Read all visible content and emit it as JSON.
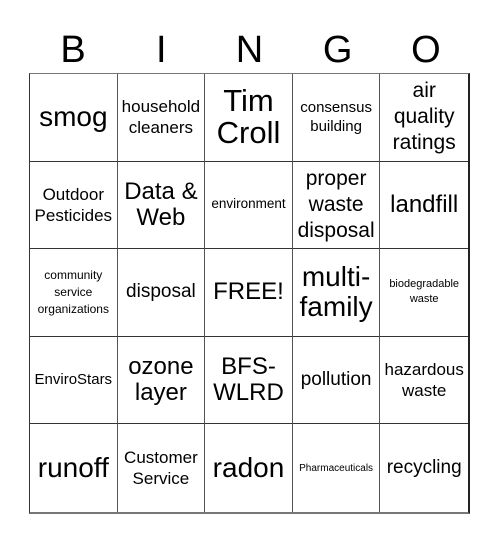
{
  "header": {
    "letters": [
      "B",
      "I",
      "N",
      "G",
      "O"
    ]
  },
  "board": {
    "free_space": "FREE!",
    "rows": [
      [
        "smog",
        "household cleaners",
        "Tim Croll",
        "consensus building",
        "air quality ratings"
      ],
      [
        "Outdoor Pesticides",
        "Data & Web",
        "environment",
        "proper waste disposal",
        "landfill"
      ],
      [
        "community service organizations",
        "disposal",
        "FREE!",
        "multi-family",
        "biodegradable waste"
      ],
      [
        "EnviroStars",
        "ozone layer",
        "BFS-WLRD",
        "pollution",
        "hazardous waste"
      ],
      [
        "runoff",
        "Customer Service",
        "radon",
        "Pharmaceuticals",
        "recycling"
      ]
    ]
  }
}
